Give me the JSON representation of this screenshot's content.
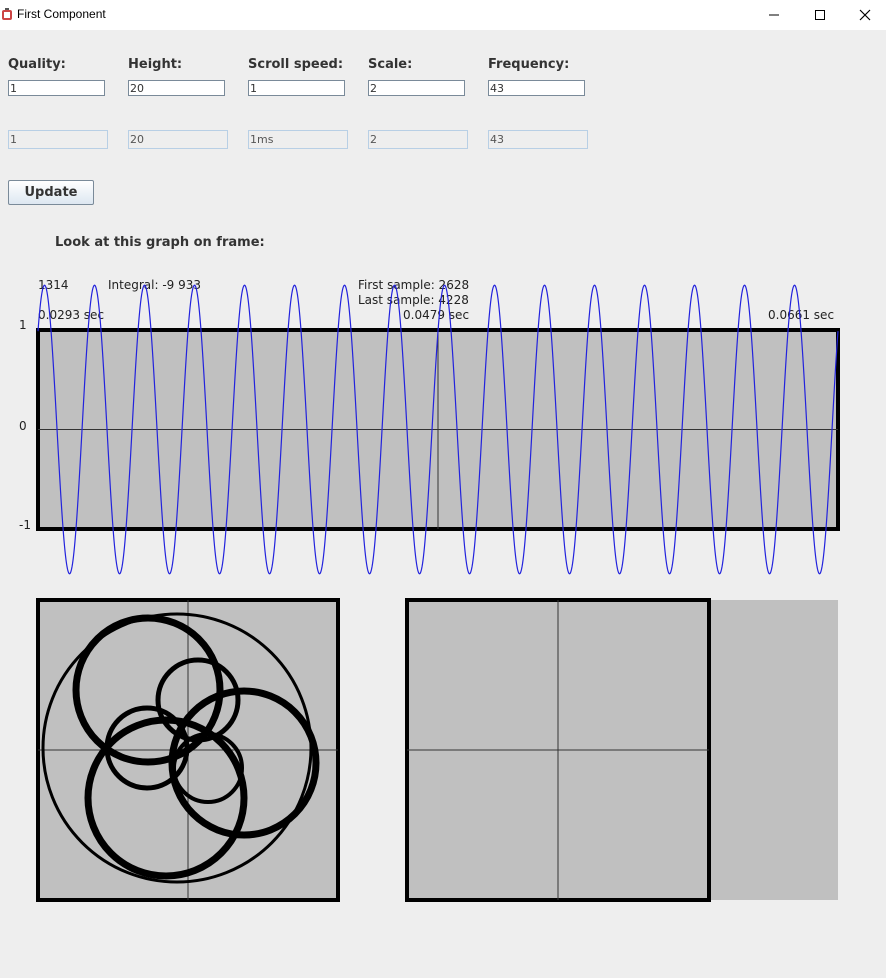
{
  "window": {
    "title": "First Component"
  },
  "controls": {
    "fields": [
      {
        "label": "Quality:",
        "value": "1",
        "display": "1"
      },
      {
        "label": "Height:",
        "value": "20",
        "display": "20"
      },
      {
        "label": "Scroll speed:",
        "value": "1",
        "display": "1ms"
      },
      {
        "label": "Scale:",
        "value": "2",
        "display": "2"
      },
      {
        "label": "Frequency:",
        "value": "43",
        "display": "43"
      }
    ],
    "update_label": "Update"
  },
  "graph": {
    "heading": "Look at this graph on frame:",
    "frame_number": "1314",
    "integral": "Integral: -9 933",
    "first_sample": "First sample: 2628",
    "last_sample": "Last sample: 4228",
    "time_start": "0.0293 sec",
    "time_mid": "0.0479 sec",
    "time_end": "0.0661 sec",
    "y_top": "1",
    "y_zero": "0",
    "y_bottom": "-1"
  },
  "chart_data": [
    {
      "type": "line",
      "x_range": [
        0.0293,
        0.0661
      ],
      "ylim": [
        -1,
        1
      ],
      "grid": false,
      "series": [
        {
          "cycles": 16,
          "amplitude": 1.45,
          "color": "#2222dd"
        }
      ]
    }
  ],
  "colors": {
    "plot_bg": "#c0c0c0",
    "wave": "#2222dd",
    "window_bg": "#eeeeee"
  }
}
